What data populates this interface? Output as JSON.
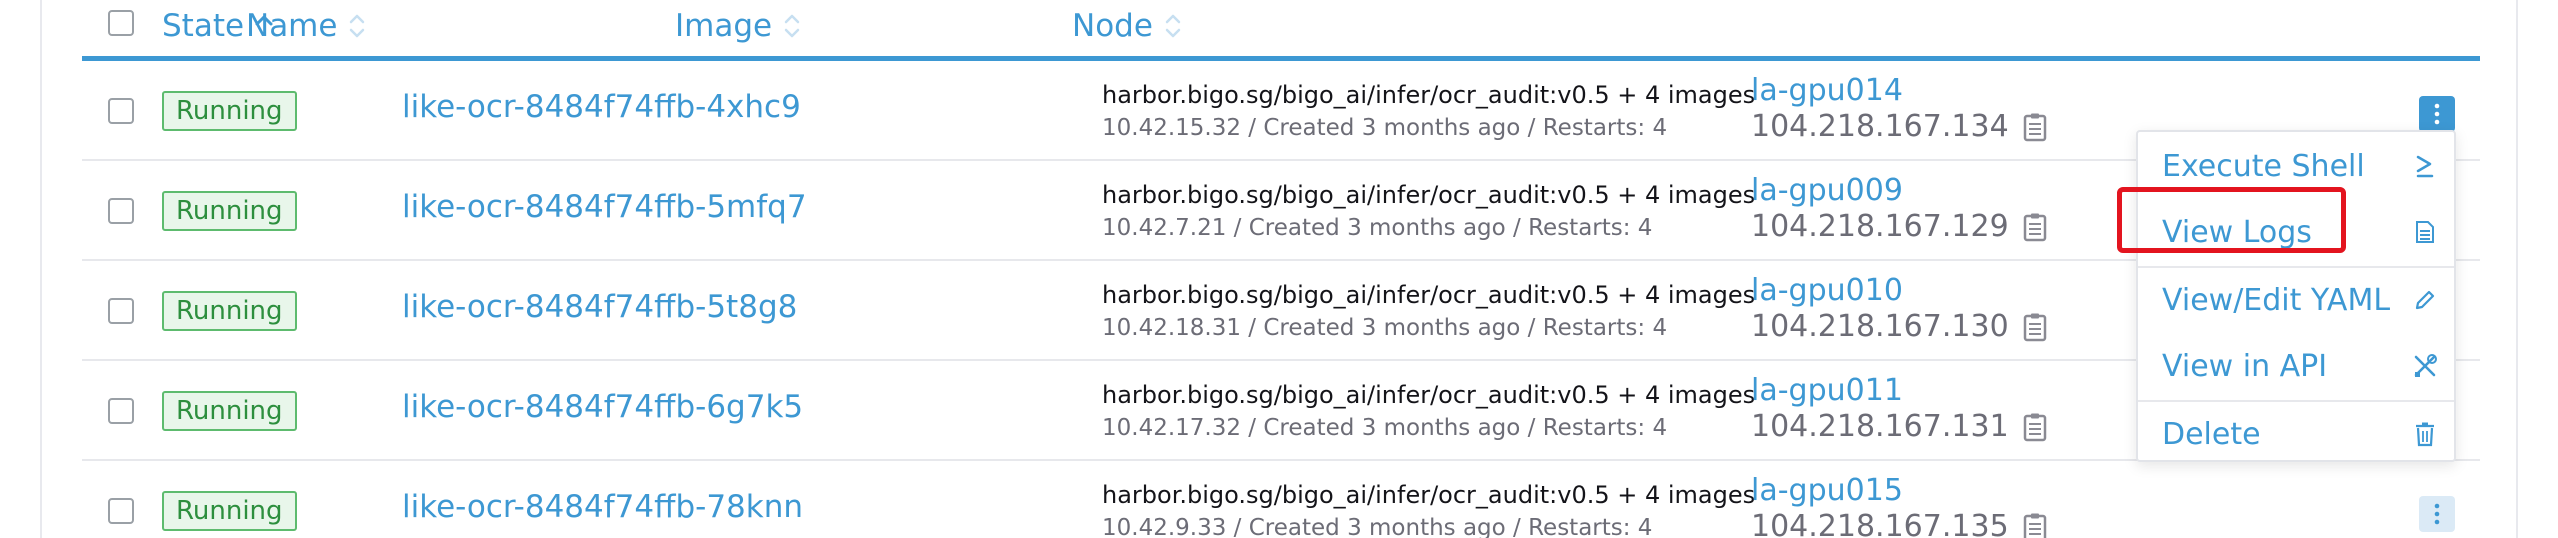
{
  "table": {
    "columns": {
      "state": "State",
      "name": "Name",
      "image": "Image",
      "node": "Node"
    },
    "rows": [
      {
        "state": "Running",
        "name": "like-ocr-8484f74ffb-4xhc9",
        "image": "harbor.bigo.sg/bigo_ai/infer/ocr_audit:v0.5 + 4 images",
        "detail": "10.42.15.32 / Created 3 months ago / Restarts: 4",
        "node": "la-gpu014",
        "node_ip": "104.218.167.134"
      },
      {
        "state": "Running",
        "name": "like-ocr-8484f74ffb-5mfq7",
        "image": "harbor.bigo.sg/bigo_ai/infer/ocr_audit:v0.5 + 4 images",
        "detail": "10.42.7.21 / Created 3 months ago / Restarts: 4",
        "node": "la-gpu009",
        "node_ip": "104.218.167.129"
      },
      {
        "state": "Running",
        "name": "like-ocr-8484f74ffb-5t8g8",
        "image": "harbor.bigo.sg/bigo_ai/infer/ocr_audit:v0.5 + 4 images",
        "detail": "10.42.18.31 / Created 3 months ago / Restarts: 4",
        "node": "la-gpu010",
        "node_ip": "104.218.167.130"
      },
      {
        "state": "Running",
        "name": "like-ocr-8484f74ffb-6g7k5",
        "image": "harbor.bigo.sg/bigo_ai/infer/ocr_audit:v0.5 + 4 images",
        "detail": "10.42.17.32 / Created 3 months ago / Restarts: 4",
        "node": "la-gpu011",
        "node_ip": "104.218.167.131"
      },
      {
        "state": "Running",
        "name": "like-ocr-8484f74ffb-78knn",
        "image": "harbor.bigo.sg/bigo_ai/infer/ocr_audit:v0.5 + 4 images",
        "detail": "10.42.9.33 / Created 3 months ago / Restarts: 4",
        "node": "la-gpu015",
        "node_ip": "104.218.167.135"
      }
    ]
  },
  "menu": {
    "items": [
      {
        "label": "Execute Shell",
        "icon": "terminal-icon"
      },
      {
        "label": "View Logs",
        "icon": "file-icon"
      },
      {
        "label": "View/Edit YAML",
        "icon": "pencil-icon"
      },
      {
        "label": "View in API",
        "icon": "tools-icon"
      },
      {
        "label": "Delete",
        "icon": "trash-icon"
      }
    ]
  },
  "colors": {
    "accent": "#3d98d3",
    "running_border": "#5dbb6e",
    "running_bg": "#e8f6ea",
    "highlight": "#e3141f"
  }
}
